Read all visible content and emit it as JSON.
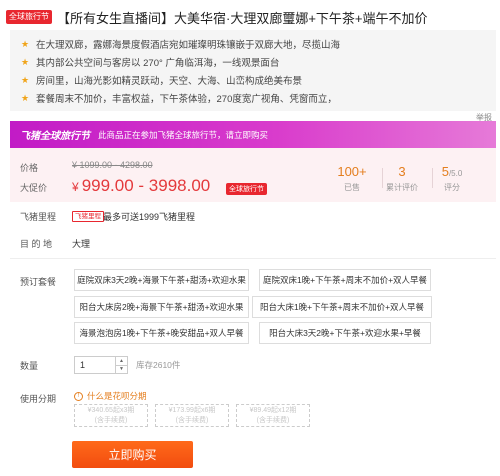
{
  "header": {
    "badge": "全球旅行节",
    "title": "【所有女生直播间】大美华宿·大理双廊璽娜+下午茶+端午不加价"
  },
  "highlights": [
    "在大理双廊，露娜海景度假酒店宛如璀璨明珠镶嵌于双廊大地，尽揽山海",
    "其内部公共空间与客房以 270° 广角临洱海，一线观景面台",
    "房间里，山海光影如精灵跃动，天空、大海、山峦构成绝美布景",
    "套餐周末不加价，丰富权益，下午茶体验，270度宽广视角、凭窗而立，"
  ],
  "report_label": "举报",
  "banner": {
    "title": "飞猪全球旅行节",
    "text": "此商品正在参加飞猪全球旅行节，请立即购买"
  },
  "price": {
    "original_label": "价格",
    "original_value": "¥ 1099.00 - 4298.00",
    "promo_label": "大促价",
    "currency": "¥",
    "promo_value": "999.00 - 3998.00",
    "promo_tag": "全球旅行节"
  },
  "stats": [
    {
      "value": "100+",
      "suffix": "",
      "label": "已售"
    },
    {
      "value": "3",
      "suffix": "",
      "label": "累计评价"
    },
    {
      "value": "5",
      "suffix": "/5.0",
      "label": "评分"
    }
  ],
  "colors": {
    "accent": "#e8272f",
    "stat": "#e47e1e",
    "buy": "#f24c0f",
    "banner": "#c21bc6"
  },
  "flypig": {
    "label": "飞猪里程",
    "tag": "飞猪里程",
    "text": "最多可送1999飞猪里程"
  },
  "destination": {
    "label": "目 的 地",
    "value": "大理"
  },
  "packages": {
    "label": "预订套餐",
    "options": [
      "庭院双床3天2晚+海景下午茶+甜汤+欢迎水果",
      "庭院双床1晚+下午茶+周末不加价+双人早餐",
      "阳台大床房2晚+海景下午茶+甜汤+欢迎水果",
      "阳台大床1晚+下午茶+周末不加价+双人早餐",
      "海景泡泡房1晚+下午茶+晚安甜品+双人早餐",
      "阳台大床3天2晚+下午茶+欢迎水果+早餐"
    ]
  },
  "quantity": {
    "label": "数量",
    "value": "1",
    "stock": "库存2610件"
  },
  "installment": {
    "label": "使用分期",
    "hint": "什么是花呗分期",
    "options": [
      {
        "line1": "¥340.65起x3期",
        "line2": "(含手续费)"
      },
      {
        "line1": "¥173.99起x6期",
        "line2": "(含手续费)"
      },
      {
        "line1": "¥89.49起x12期",
        "line2": "(含手续费)"
      }
    ]
  },
  "buy_label": "立即购买"
}
